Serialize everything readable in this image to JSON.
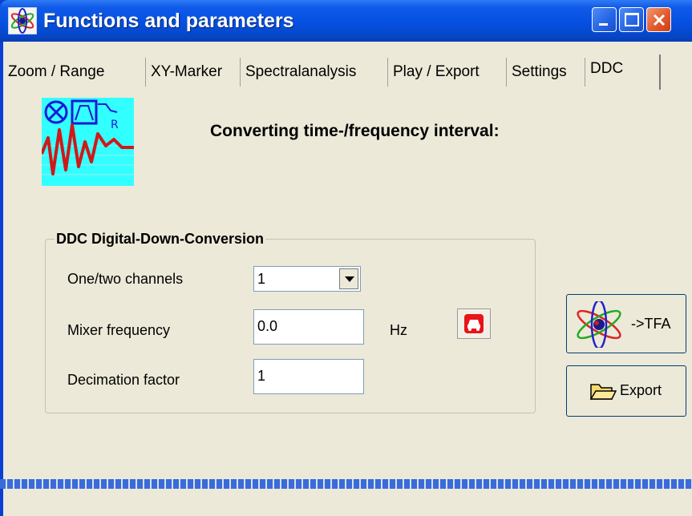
{
  "window": {
    "title": "Functions and parameters",
    "icon": "atom-icon"
  },
  "tabs": [
    {
      "label": "Zoom / Range"
    },
    {
      "label": "XY-Marker"
    },
    {
      "label": "Spectralanalysis"
    },
    {
      "label": "Play / Export"
    },
    {
      "label": "Settings"
    },
    {
      "label": "DDC",
      "active": true
    }
  ],
  "panel": {
    "heading": "Converting time-/frequency interval:",
    "icon": "signal-filter-icon"
  },
  "group": {
    "title": "DDC Digital-Down-Conversion",
    "channels_label": "One/two channels",
    "channels_value": "1",
    "mixer_label": "Mixer frequency",
    "mixer_value": "0.0",
    "mixer_unit": "Hz",
    "decimation_label": "Decimation factor",
    "decimation_value": "1"
  },
  "buttons": {
    "tfa_label": "->TFA",
    "export_label": "Export"
  },
  "colors": {
    "titlebar": "#0550e0",
    "client_bg": "#ece9d8",
    "accent_red": "#e8141a"
  }
}
